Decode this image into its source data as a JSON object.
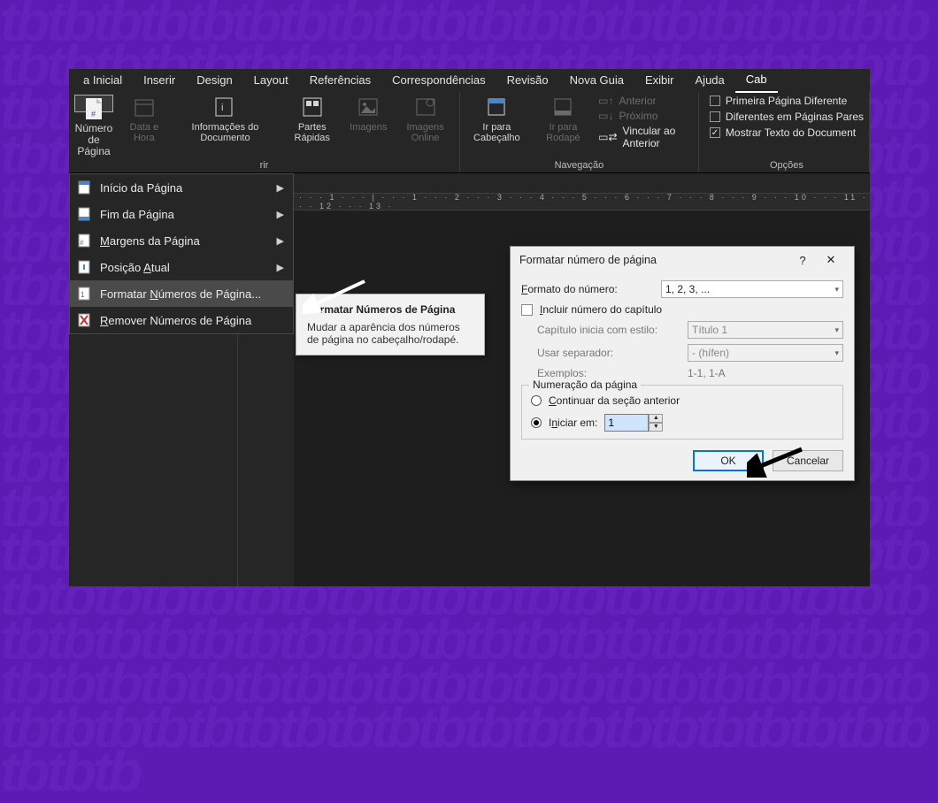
{
  "tabs": {
    "home": "a Inicial",
    "insert": "Inserir",
    "design": "Design",
    "layout": "Layout",
    "references": "Referências",
    "mailings": "Correspondências",
    "review": "Revisão",
    "new_tab": "Nova Guia",
    "view": "Exibir",
    "help": "Ajuda",
    "header_footer": "Cab"
  },
  "ribbon": {
    "group_header_footer": {
      "page_number": "Número de Página",
      "date_time": "Data e Hora",
      "doc_info": "Informações do Documento",
      "quick_parts": "Partes Rápidas",
      "images": "Imagens",
      "online_images": "Imagens Online",
      "label": "rir"
    },
    "group_nav": {
      "goto_header": "Ir para Cabeçalho",
      "goto_footer": "Ir para Rodapé",
      "previous": "Anterior",
      "next": "Próximo",
      "link_previous": "Vincular ao Anterior",
      "label": "Navegação"
    },
    "group_options": {
      "diff_first": "Primeira Página Diferente",
      "diff_odd_even": "Diferentes em Páginas Pares",
      "show_doc_text": "Mostrar Texto do Document",
      "label": "Opções"
    }
  },
  "menu": {
    "top_of_page": "Início da Página",
    "bottom_of_page": "Fim da Página",
    "page_margins": "Margens da Página",
    "current_position": "Posição Atual",
    "format_numbers": "Formatar Números de Página...",
    "remove_numbers": "Remover Números de Página"
  },
  "tooltip": {
    "title": "Formatar Números de Página",
    "desc": "Mudar a aparência dos números de página no cabeçalho/rodapé."
  },
  "ruler": "· · · 1 · · · | · · · 1 · · · 2 · · · 3 · · · 4 · · · 5 · · · 6 · · · 7 · · · 8 · · · 9 · · · 10 · · · 11 · · · 12 · · · 13 ·",
  "dialog": {
    "title": "Formatar número de página",
    "help": "?",
    "close": "✕",
    "format_label": "Formato do número:",
    "format_value": "1, 2, 3, ...",
    "include_chapter": "Incluir número do capítulo",
    "chapter_style_label": "Capítulo inicia com estilo:",
    "chapter_style_value": "Título 1",
    "separator_label": "Usar separador:",
    "separator_value": "-   (hífen)",
    "examples_label": "Exemplos:",
    "examples_value": "1-1, 1-A",
    "numbering_legend": "Numeração da página",
    "continue_prev": "Continuar da seção anterior",
    "start_at": "Iniciar em:",
    "start_at_value": "1",
    "ok": "OK",
    "cancel": "Cancelar"
  }
}
